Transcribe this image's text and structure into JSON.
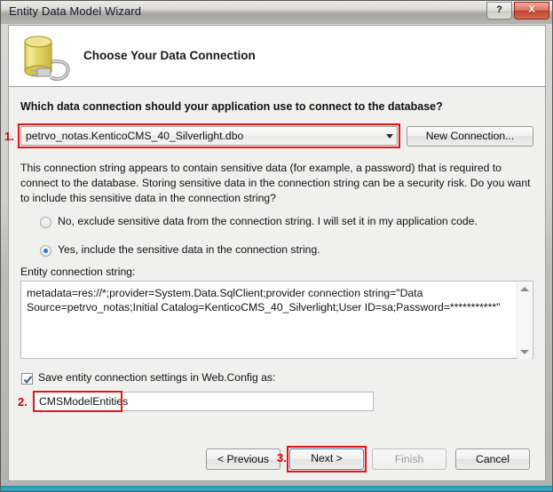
{
  "window": {
    "title": "Entity Data Model Wizard",
    "help_button": "?",
    "close_button": "X"
  },
  "header": {
    "title": "Choose Your Data Connection",
    "icon": "database-connection-icon"
  },
  "main": {
    "question": "Which data connection should your application use to connect to the database?",
    "connection_combo": {
      "value": "petrvo_notas.KenticoCMS_40_Silverlight.dbo",
      "arrow_icon": "chevron-down-icon"
    },
    "new_connection_label": "New Connection...",
    "sensitive_paragraph": "This connection string appears to contain sensitive data (for example, a password) that is required to connect to the database. Storing sensitive data in the connection string can be a security risk. Do you want to include this sensitive data in the connection string?",
    "radios": [
      {
        "label": "No, exclude sensitive data from the connection string. I will set it in my application code.",
        "selected": false
      },
      {
        "label": "Yes, include the sensitive data in the connection string.",
        "selected": true
      }
    ],
    "connection_string_label": "Entity connection string:",
    "connection_string_value": "metadata=res://*;provider=System.Data.SqlClient;provider connection string=\"Data Source=petrvo_notas;Initial Catalog=KenticoCMS_40_Silverlight;User ID=sa;Password=***********\"",
    "save_checkbox": {
      "label": "Save entity connection settings in Web.Config as:",
      "checked": true
    },
    "entities_name_value": "CMSModelEntities"
  },
  "footer": {
    "previous_label": "< Previous",
    "next_label": "Next >",
    "finish_label": "Finish",
    "cancel_label": "Cancel"
  },
  "annotations": {
    "one": "1.",
    "two": "2.",
    "three": "3."
  },
  "colors": {
    "annotation_red": "#d40000",
    "highlight_border": "#e81313",
    "accent_blue": "#2e7fc4",
    "bottom_strip": "#2a93ab",
    "close_button": "#c2452e"
  }
}
